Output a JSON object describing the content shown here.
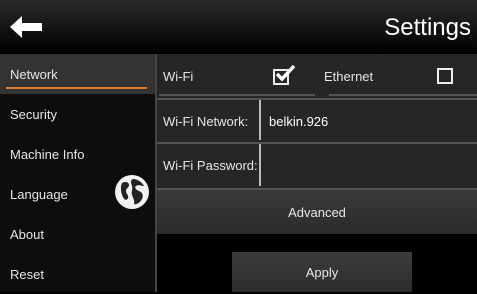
{
  "header": {
    "title": "Settings",
    "back_icon": "arrow-left-icon"
  },
  "sidebar": {
    "items": [
      {
        "label": "Network",
        "active": true
      },
      {
        "label": "Security"
      },
      {
        "label": "Machine Info"
      },
      {
        "label": "Language"
      },
      {
        "label": "About"
      },
      {
        "label": "Reset"
      }
    ],
    "language_icon": "globe-icon"
  },
  "network": {
    "wifi": {
      "label": "Wi-Fi",
      "checked": true
    },
    "ethernet": {
      "label": "Ethernet",
      "checked": false
    },
    "wifi_network": {
      "label": "Wi-Fi Network:",
      "value": "belkin.926"
    },
    "wifi_password": {
      "label": "Wi-Fi Password:",
      "value": ""
    },
    "advanced_label": "Advanced",
    "apply_label": "Apply"
  },
  "colors": {
    "accent": "#e07a2c",
    "background": "#000000",
    "panel": "#262626"
  }
}
